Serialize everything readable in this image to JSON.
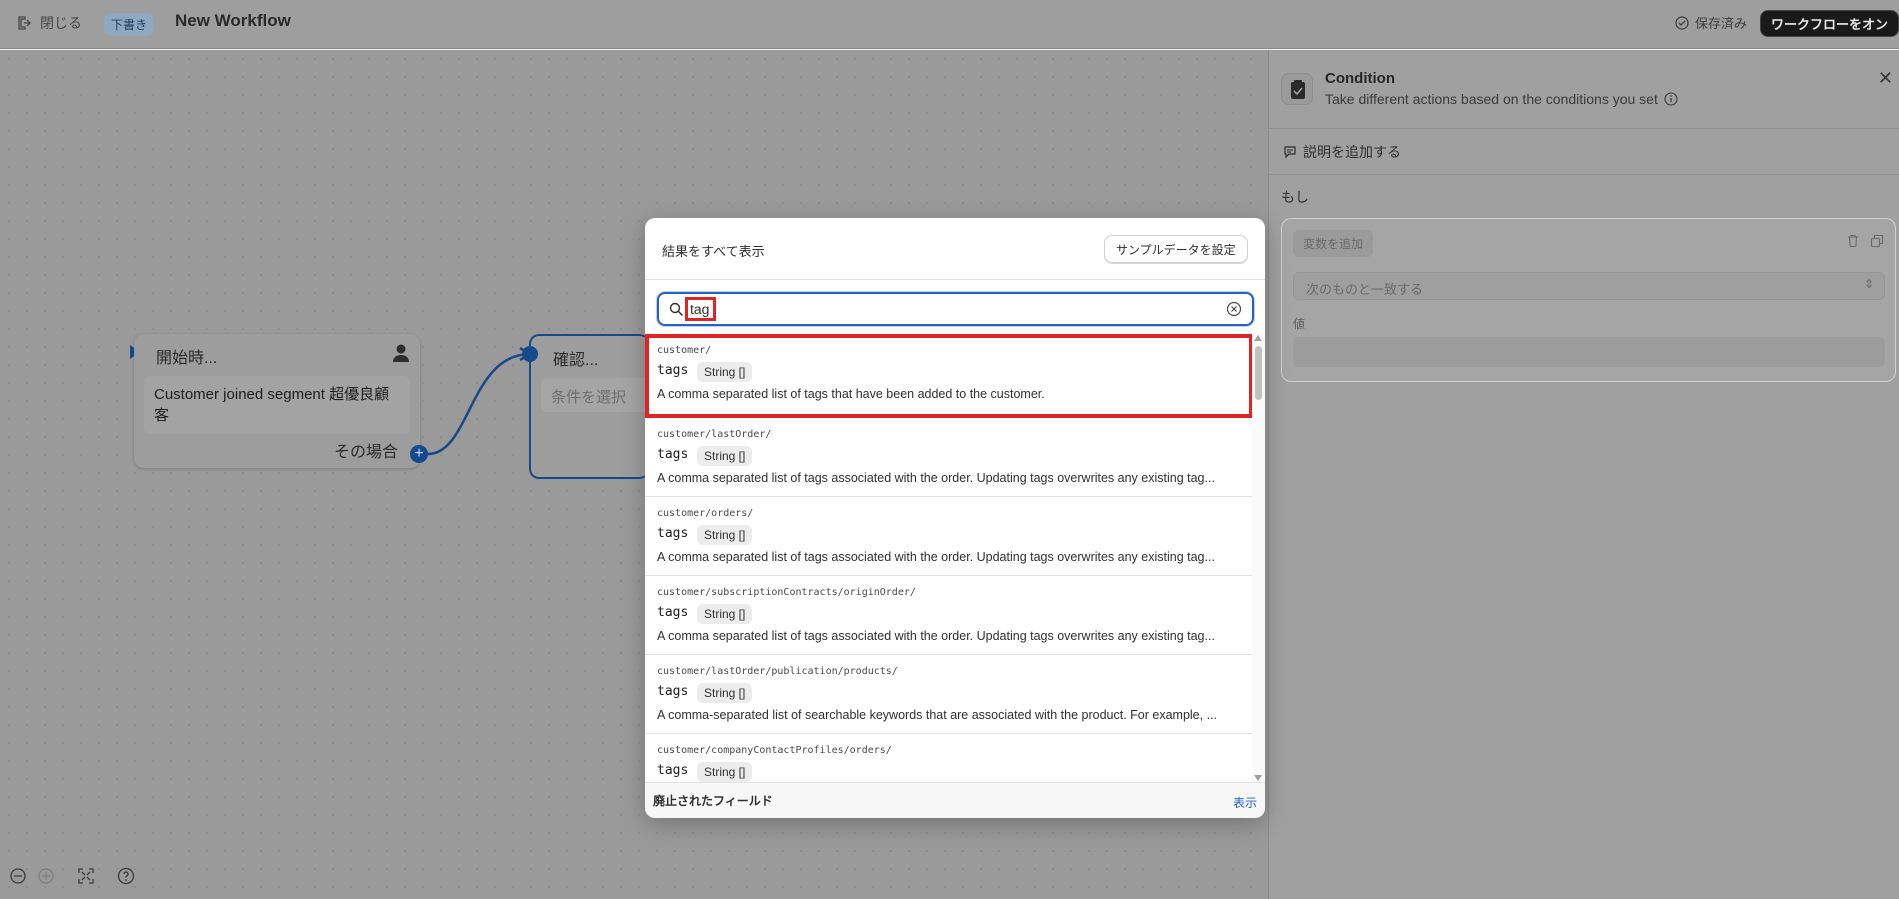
{
  "topbar": {
    "close_label": "閉じる",
    "draft_badge": "下書き",
    "title": "New Workflow",
    "saved_label": "保存済み",
    "turn_on_label": "ワークフローをオン"
  },
  "canvas": {
    "start_node": {
      "heading": "開始時...",
      "body": "Customer joined segment 超優良顧客",
      "footer": "その場合"
    },
    "check_node": {
      "heading": "確認...",
      "placeholder": "条件を選択"
    }
  },
  "panel": {
    "title": "Condition",
    "subtitle": "Take different actions based on the conditions you set",
    "add_description": "説明を追加する",
    "if_label": "もし",
    "add_variable": "変数を追加",
    "match_placeholder": "次のものと一致する",
    "value_label": "値"
  },
  "modal": {
    "title": "結果をすべて表示",
    "sample_data_button": "サンプルデータを設定",
    "search_value": "tag",
    "results": [
      {
        "path": "customer/",
        "name": "tags",
        "type": "String []",
        "description": "A comma separated list of tags that have been added to the customer."
      },
      {
        "path": "customer/lastOrder/",
        "name": "tags",
        "type": "String []",
        "description": "A comma separated list of tags associated with the order. Updating tags overwrites any existing tag..."
      },
      {
        "path": "customer/orders/",
        "name": "tags",
        "type": "String []",
        "description": "A comma separated list of tags associated with the order. Updating tags overwrites any existing tag..."
      },
      {
        "path": "customer/subscriptionContracts/originOrder/",
        "name": "tags",
        "type": "String []",
        "description": "A comma separated list of tags associated with the order. Updating tags overwrites any existing tag..."
      },
      {
        "path": "customer/lastOrder/publication/products/",
        "name": "tags",
        "type": "String []",
        "description": "A comma-separated list of searchable keywords that are associated with the product. For example, ..."
      },
      {
        "path": "customer/companyContactProfiles/orders/",
        "name": "tags",
        "type": "String []",
        "description": ""
      }
    ],
    "footer_label": "廃止されたフィールド",
    "footer_action": "表示"
  }
}
